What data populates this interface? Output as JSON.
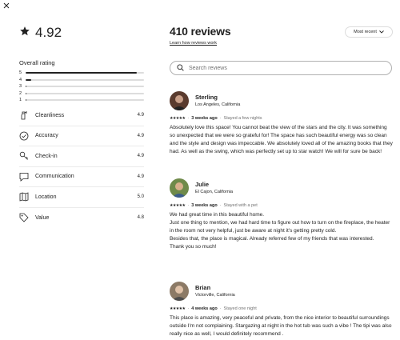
{
  "close_icon": "close-icon",
  "rating": {
    "average": "4.92",
    "overall_label": "Overall rating"
  },
  "rating_distribution": [
    {
      "stars": "5",
      "fraction": 0.94
    },
    {
      "stars": "4",
      "fraction": 0.05
    },
    {
      "stars": "3",
      "fraction": 0.01
    },
    {
      "stars": "2",
      "fraction": 0.005
    },
    {
      "stars": "1",
      "fraction": 0.005
    }
  ],
  "categories": [
    {
      "label": "Cleanliness",
      "value": "4.9",
      "icon": "spray-bottle-icon"
    },
    {
      "label": "Accuracy",
      "value": "4.9",
      "icon": "check-circle-icon"
    },
    {
      "label": "Check-in",
      "value": "4.9",
      "icon": "key-icon"
    },
    {
      "label": "Communication",
      "value": "4.9",
      "icon": "message-icon"
    },
    {
      "label": "Location",
      "value": "5.0",
      "icon": "map-icon"
    },
    {
      "label": "Value",
      "value": "4.8",
      "icon": "tag-icon"
    }
  ],
  "reviews_header": {
    "title": "410 reviews",
    "learn_link": "Learn how reviews work",
    "sort_label": "Most recent"
  },
  "search": {
    "placeholder": "Search reviews",
    "value": ""
  },
  "reviews": [
    {
      "name": "Sterling",
      "location": "Los Angeles, California",
      "stars": "★★★★★",
      "when": "3 weeks ago",
      "stay": "Stayed a few nights",
      "avatar_color": "#5a3b2e",
      "body": [
        "Absolutely love this space! You cannot beat the view of the stars and the city. It was something so unexpected that we were so grateful for! The space has such beautiful energy was so clean and the style and design was impeccable. We absolutely loved all of the amazing books that they had. As well as the swing, which was perfectly set up to star watch! We will for sure be back!"
      ]
    },
    {
      "name": "Julie",
      "location": "El Cajon, California",
      "stars": "★★★★★",
      "when": "3 weeks ago",
      "stay": "Stayed with a pet",
      "avatar_color": "#6f8a4a",
      "body": [
        "We had great time in this beautiful home.",
        "Just one thing to mention, we had hard time to figure out how to turn on the fireplace, the heater in the room  not very helpful, just be aware at night it's getting pretty cold.",
        "Besides that, the place is magical. Already referred few of my friends that was interested.",
        "Thank you so much!"
      ]
    },
    {
      "name": "Brian",
      "location": "Victorville, California",
      "stars": "★★★★★",
      "when": "4 weeks ago",
      "stay": "Stayed one night",
      "avatar_color": "#8c7a66",
      "body": [
        "This place is amazing, very peaceful and private, from the nice interior to beautiful surroundings outside I'm not complaining. Stargazing at night in the hot tub was such a vibe ! The tipi was also really nice as well, I would definitely recommend ."
      ]
    }
  ]
}
